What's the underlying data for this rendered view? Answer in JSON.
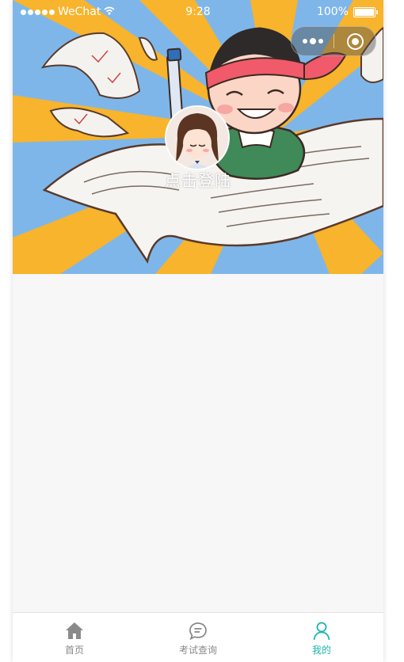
{
  "status_bar": {
    "carrier": "WeChat",
    "time": "9:28",
    "battery": "100%"
  },
  "profile": {
    "login_label": "点击登陆"
  },
  "tab_bar": {
    "items": [
      {
        "label": "首页",
        "icon": "home-icon",
        "active": false
      },
      {
        "label": "考试查询",
        "icon": "chat-icon",
        "active": false
      },
      {
        "label": "我的",
        "icon": "user-icon",
        "active": true
      }
    ]
  },
  "colors": {
    "accent": "#1bb6ae",
    "inactive": "#8a8a8a",
    "banner_blue": "#7fb6ea",
    "banner_yellow": "#f7b42c"
  }
}
